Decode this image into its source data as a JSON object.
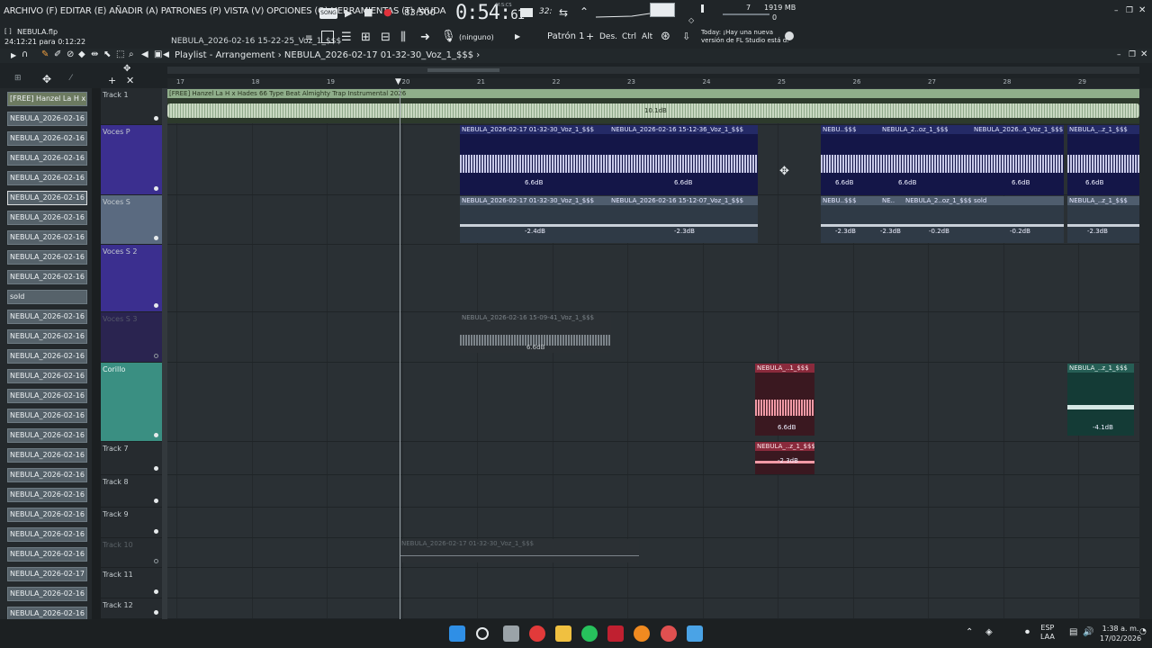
{
  "menu": {
    "text": "ARCHIVO (F) EDITAR (E) AÑADIR (A) PATRONES (P) VISTA (V) OPCIONES (O) HERRAMIENTAS (T) AYUDA",
    "song_badge": "SONG"
  },
  "transport": {
    "tempo": "83.500",
    "time_main": "0:54:",
    "time_sub": "61",
    "time_unit": "M:S:CS",
    "counter": "7",
    "memory": "1919 MB",
    "voices": "0"
  },
  "file": {
    "name": "NEBULA.flp",
    "elapsed": "24:12:21 para 0:12:22",
    "hint": "NEBULA_2026-02-16 15-22-25_Voz_1_$$$",
    "pattern_none": "(ninguno)",
    "pattern": "Patrón 1",
    "mods": [
      "Des.",
      "Ctrl",
      "Alt"
    ],
    "news_line1": "Today: ¡Hay una nueva",
    "news_line2": "versión de FL Studio está d."
  },
  "playlist": {
    "title": "Playlist - Arrangement",
    "separator": "›",
    "clip_name": "NEBULA_2026-02-17 01-32-30_Voz_1_$$$"
  },
  "timeline": {
    "marks": [
      "17",
      "18",
      "19",
      "20",
      "21",
      "22",
      "23",
      "24",
      "25",
      "26",
      "27",
      "28",
      "29"
    ]
  },
  "picker": [
    "[FREE] Hanzel La H x...",
    "NEBULA_2026-02-16 14-",
    "NEBULA_2026-02-16 14-",
    "NEBULA_2026-02-16 15-",
    "NEBULA_2026-02-16 15-",
    "NEBULA_2026-02-16 15-",
    "NEBULA_2026-02-16 15-",
    "NEBULA_2026-02-16 15-",
    "NEBULA_2026-02-16 15-",
    "NEBULA_2026-02-16 15-",
    "sold",
    "NEBULA_2026-02-16 15-",
    "NEBULA_2026-02-16 15-",
    "NEBULA_2026-02-16 15-",
    "NEBULA_2026-02-16 16-",
    "NEBULA_2026-02-16 16-",
    "NEBULA_2026-02-16 16-",
    "NEBULA_2026-02-16 16-",
    "NEBULA_2026-02-16 16-",
    "NEBULA_2026-02-16 16-",
    "NEBULA_2026-02-16 16-",
    "NEBULA_2026-02-16 16-",
    "NEBULA_2026-02-16 16-",
    "NEBULA_2026-02-16 16-",
    "NEBULA_2026-02-17 17-",
    "NEBULA_2026-02-16 17-",
    "NEBULA_2026-02-16 17-"
  ],
  "tracks": [
    {
      "name": "Track 1"
    },
    {
      "name": "Voces P"
    },
    {
      "name": "Voces S"
    },
    {
      "name": "Voces S 2"
    },
    {
      "name": "Voces S 3"
    },
    {
      "name": "Corillo"
    },
    {
      "name": "Track 7"
    },
    {
      "name": "Track 8"
    },
    {
      "name": "Track 9"
    },
    {
      "name": "Track 10"
    },
    {
      "name": "Track 11"
    },
    {
      "name": "Track 12"
    }
  ],
  "clips": {
    "beat": {
      "title": "[FREE] Hanzel La H x Hades 66 Type Beat Almighty  Trap Instrumental 2026",
      "gain": "10.1dB"
    },
    "vp1": {
      "title": "NEBULA_2026-02-17 01-32-30_Voz_1_$$$",
      "gain": "6.6dB"
    },
    "vp2": {
      "title": "NEBULA_2026-02-16 15-12-36_Voz_1_$$$",
      "gain": "6.6dB"
    },
    "vp3": {
      "title": "NEBU..$$$",
      "gain": "6.6dB"
    },
    "vp4": {
      "title": "NEBULA_2..oz_1_$$$",
      "gain": "6.6dB"
    },
    "vp5": {
      "title": "NEBULA_2026..4_Voz_1_$$$",
      "gain": "6.6dB"
    },
    "vp6": {
      "title": "NEBULA_..z_1_$$$",
      "gain": "6.6dB"
    },
    "vs1": {
      "title": "NEBULA_2026-02-17 01-32-30_Voz_1_$$$",
      "gain": "-2.4dB"
    },
    "vs2": {
      "title": "NEBULA_2026-02-16 15-12-07_Voz_1_$$$",
      "gain": "-2.3dB"
    },
    "vs3": {
      "title": "NEBU..$$$",
      "gain": "-2.3dB"
    },
    "vs4": {
      "title": "NEBULA_2..oz_1_$$$",
      "gain": "-0.2dB"
    },
    "vs5": {
      "title": "sold",
      "gain": "-0.2dB"
    },
    "vs6": {
      "title": "NEBULA_..z_1_$$$",
      "gain": "-2.3dB"
    },
    "vs7": {
      "title": "NE..",
      "gain": "-2.3dB"
    },
    "muted1": {
      "title": "NEBULA_2026-02-16 15-09-41_Voz_1_$$$",
      "gain": "6.6dB"
    },
    "cor1": {
      "title": "NEBULA_..1_$$$",
      "gain": "6.6dB"
    },
    "cor2": {
      "title": "NEBULA_..z_1_$$$",
      "gain": "-4.1dB"
    },
    "t7": {
      "title": "NEBULA_..z_1_$$$",
      "gain": "-2.3dB"
    },
    "muted2": {
      "title": "NEBULA_2026-02-17 01-32-30_Voz_1_$$$"
    }
  },
  "tray": {
    "lang_line1": "ESP",
    "lang_line2": "LAA",
    "time": "1:38 a. m.",
    "date": "17/02/2026"
  },
  "colors": {
    "voices_clip": "#1d1f5a",
    "voices_head": "#3b2f8f",
    "corillo_head": "#3a8f82",
    "corillo_clip_red": "#7a2636",
    "beat_clip": "#8fae8a"
  }
}
